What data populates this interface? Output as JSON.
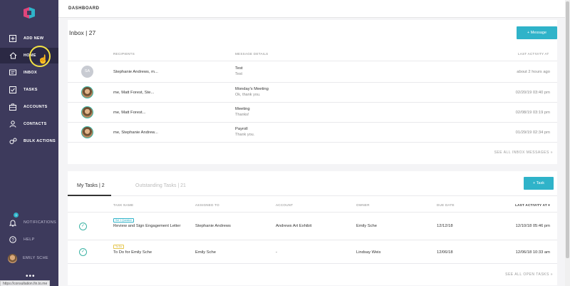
{
  "sidebar": {
    "items": [
      {
        "label": "ADD NEW",
        "icon": "plus-square-icon"
      },
      {
        "label": "HOME",
        "icon": "home-icon"
      },
      {
        "label": "INBOX",
        "icon": "inbox-icon"
      },
      {
        "label": "TASKS",
        "icon": "checkbox-icon"
      },
      {
        "label": "ACCOUNTS",
        "icon": "briefcase-icon"
      },
      {
        "label": "CONTACTS",
        "icon": "person-icon"
      },
      {
        "label": "BULK ACTIONS",
        "icon": "gears-icon"
      }
    ],
    "bottom": {
      "notifications": "NOTIFICATIONS",
      "notifications_count": "3",
      "help": "HELP",
      "user": "EMILY SCHE"
    },
    "status_url": "https://consultation.fin.to.me"
  },
  "topbar": {
    "title": "DASHBOARD"
  },
  "inbox": {
    "title": "Inbox | 27",
    "button": "+ Message",
    "headers": [
      "RECIPIENTS",
      "MESSAGE DETAILS",
      "LAST ACTIVITY AT"
    ],
    "rows": [
      {
        "avatar": "SA",
        "recipients": "Stephanie Andrews, m...",
        "subject": "Test",
        "preview": "Test",
        "time": "about 2 hours ago"
      },
      {
        "avatar": "",
        "recipients": "me, Matt Forest, Ste...",
        "subject": "Monday's Meeting",
        "preview": "Ok, thank you.",
        "time": "02/20/19 03:40 pm"
      },
      {
        "avatar": "",
        "recipients": "me, Matt Forest...",
        "subject": "Meeting",
        "preview": "Thanks!",
        "time": "02/08/19 03:19 pm"
      },
      {
        "avatar": "",
        "recipients": "me, Stephanie Andrew...",
        "subject": "Payroll",
        "preview": "Thank you.",
        "time": "01/29/19 02:34 pm"
      }
    ],
    "see_all": "SEE ALL INBOX MESSAGES »"
  },
  "tasks": {
    "tab_active": "My Tasks | 2",
    "tab_inactive": "Outstanding Tasks | 21",
    "button": "+ Task",
    "headers": [
      "TASK NAME",
      "ASSIGNED TO",
      "ACCOUNT",
      "OWNER",
      "DUE DATE",
      "LAST ACTIVITY AT ▾"
    ],
    "rows": [
      {
        "tag": "Set 1 Question",
        "tag_color": "#2fb3c9",
        "name": "Review and Sign Engagement Letter",
        "assigned": "Stephanie Andrews",
        "account": "Andrews Art Exhibit",
        "owner": "Emily Sche",
        "due": "12/12/18",
        "activity": "12/10/18 05:46 pm"
      },
      {
        "tag": "To Do",
        "tag_color": "#e6c74c",
        "name": "To Do for Emily Sche",
        "assigned": "Emily Sche",
        "account": "-",
        "owner": "Lindsay Weis",
        "due": "12/06/18",
        "activity": "12/06/18 10:33 am"
      }
    ],
    "see_all": "SEE ALL OPEN TASKS »"
  },
  "colors": {
    "sidebar": "#3d3a5c",
    "accent": "#2fb3c9",
    "check": "#3cb3a4"
  }
}
